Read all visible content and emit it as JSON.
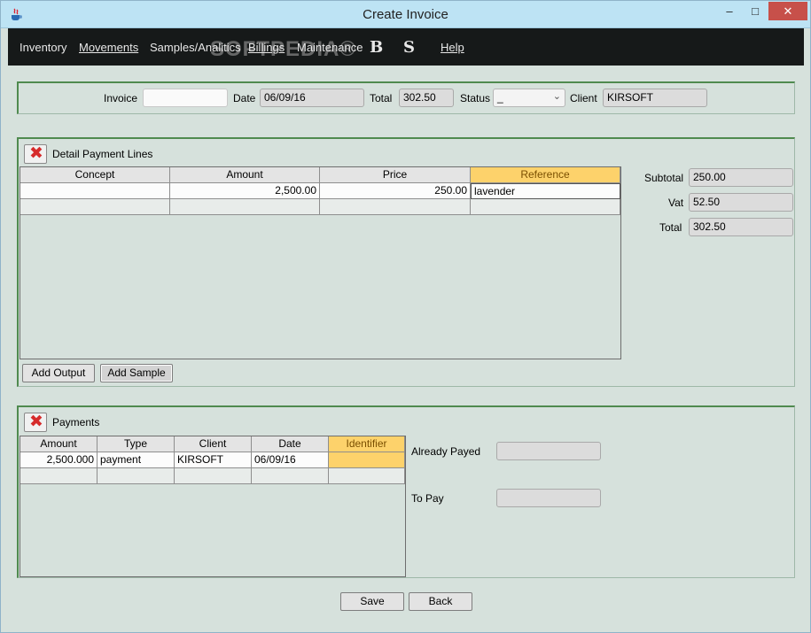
{
  "window": {
    "title": "Create Invoice",
    "min": "–",
    "max": "□",
    "close": "✕"
  },
  "menu": {
    "items": [
      "Inventory",
      "Movements",
      "Samples/Analitics",
      "Billings",
      "Maintenance",
      "Help"
    ],
    "icon_b": "B",
    "icon_s": "S",
    "watermark": "SOFTPEDIA®"
  },
  "header": {
    "invoice_label": "Invoice",
    "invoice_value": "",
    "date_label": "Date",
    "date_value": "06/09/16",
    "total_label": "Total",
    "total_value": "302.50",
    "status_label": "Status",
    "status_value": "_",
    "client_label": "Client",
    "client_value": "KIRSOFT"
  },
  "details": {
    "title": "Detail Payment Lines",
    "columns": [
      "Concept",
      "Amount",
      "Price",
      "Reference"
    ],
    "rows": [
      [
        "",
        "2,500.00",
        "250.00",
        "lavender"
      ],
      [
        "",
        "",
        "",
        ""
      ]
    ],
    "add_output": "Add Output",
    "add_sample": "Add Sample",
    "subtotal_label": "Subtotal",
    "subtotal_value": "250.00",
    "vat_label": "Vat",
    "vat_value": "52.50",
    "total_label": "Total",
    "total_value": "302.50"
  },
  "payments": {
    "title": "Payments",
    "columns": [
      "Amount",
      "Type",
      "Client",
      "Date",
      "Identifier"
    ],
    "rows": [
      [
        "2,500.000",
        "payment",
        "KIRSOFT",
        "06/09/16",
        ""
      ],
      [
        "",
        "",
        "",
        "",
        ""
      ]
    ],
    "already_payed_label": "Already Payed",
    "already_payed_value": "",
    "to_pay_label": "To Pay",
    "to_pay_value": ""
  },
  "footer": {
    "save": "Save",
    "back": "Back"
  },
  "colors": {
    "menubar": "#161919",
    "selected_header": "#fdd26b",
    "panel": "#d6e1dc",
    "accent_border": "#4f8a4f"
  }
}
